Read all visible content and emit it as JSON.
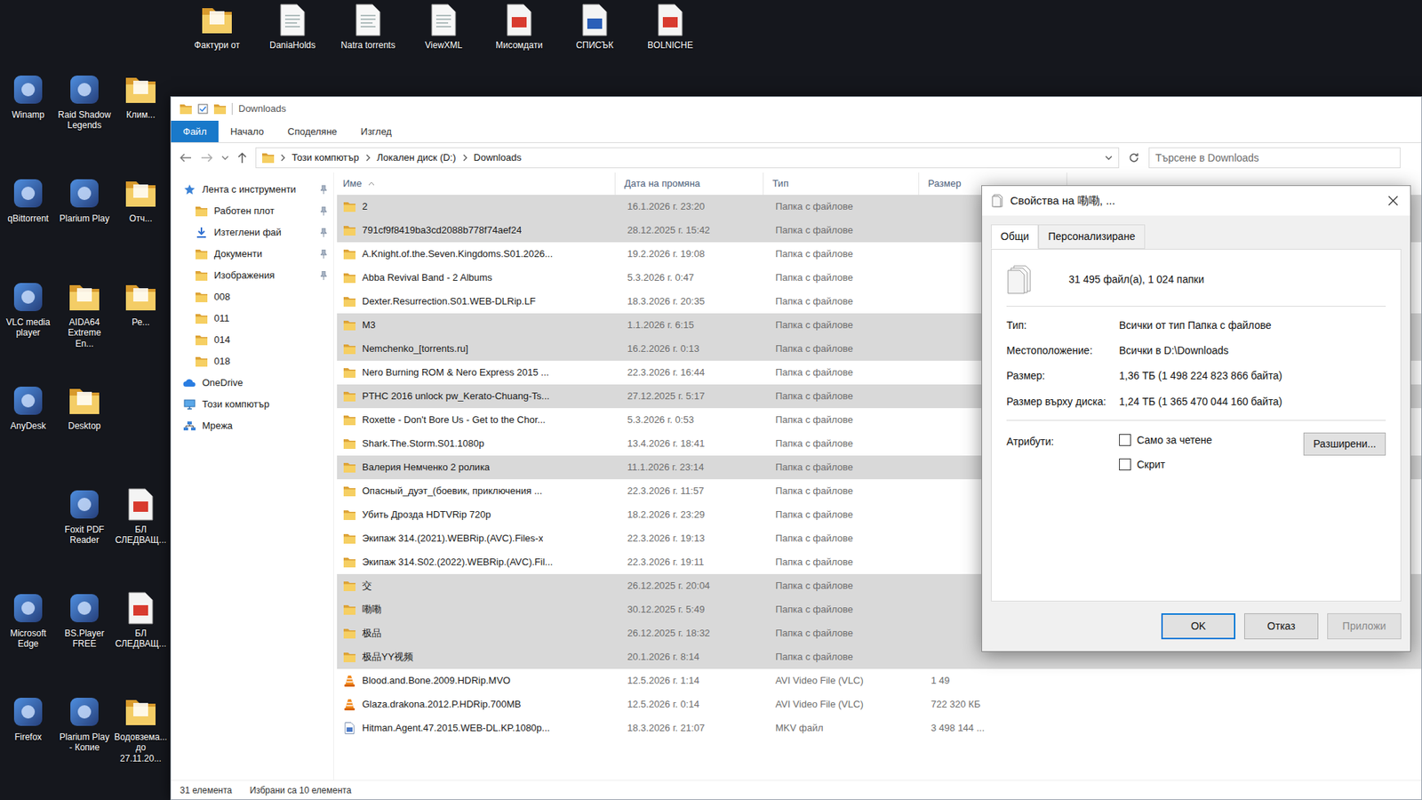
{
  "desktop": {
    "top_icons": [
      {
        "label": "Фактури от",
        "kind": "folder"
      },
      {
        "label": "DaniaHolds",
        "kind": "doc"
      },
      {
        "label": "Natra torrents",
        "kind": "doc"
      },
      {
        "label": "ViewXML",
        "kind": "doc"
      },
      {
        "label": "Мисомдати",
        "kind": "pdf"
      },
      {
        "label": "СПИСЪК",
        "kind": "word"
      },
      {
        "label": "BOLNICHE",
        "kind": "pdf"
      }
    ],
    "icons": [
      {
        "label": "Winamp",
        "kind": "app"
      },
      {
        "label": "Raid Shadow Legends",
        "kind": "app"
      },
      {
        "label": "Клим...",
        "kind": "folder"
      },
      {
        "label": "qBittorrent",
        "kind": "app"
      },
      {
        "label": "Plarium Play",
        "kind": "app"
      },
      {
        "label": "Отч...",
        "kind": "folder"
      },
      {
        "label": "VLC media player",
        "kind": "app"
      },
      {
        "label": "AIDA64 Extreme En...",
        "kind": "folder"
      },
      {
        "label": "Ре...",
        "kind": "folder"
      },
      {
        "label": "AnyDesk",
        "kind": "app"
      },
      {
        "label": "Desktop",
        "kind": "folder"
      },
      {
        "label": "",
        "kind": "empty"
      },
      {
        "label": "",
        "kind": "empty"
      },
      {
        "label": "Foxit PDF Reader",
        "kind": "app"
      },
      {
        "label": "БЛ СЛЕДВАЩ...",
        "kind": "pdf"
      },
      {
        "label": "Microsoft Edge",
        "kind": "app"
      },
      {
        "label": "BS.Player FREE",
        "kind": "app"
      },
      {
        "label": "БЛ СЛЕДВАЩ...",
        "kind": "pdf"
      },
      {
        "label": "Firefox",
        "kind": "app"
      },
      {
        "label": "Plarium Play - Копие",
        "kind": "app"
      },
      {
        "label": "Водовзема... до 27.11.20...",
        "kind": "folder"
      }
    ]
  },
  "explorer": {
    "title": "Downloads",
    "ribbon_tabs": [
      {
        "label": "Файл",
        "selected": true
      },
      {
        "label": "Начало",
        "selected": false
      },
      {
        "label": "Споделяне",
        "selected": false
      },
      {
        "label": "Изглед",
        "selected": false
      }
    ],
    "address": [
      "Този компютър",
      "Локален диск (D:)",
      "Downloads"
    ],
    "search": {
      "placeholder": "Търсене в Downloads"
    },
    "nav": [
      {
        "label": "Лента с инструменти",
        "kind": "quick",
        "pinned": true
      },
      {
        "label": "Работен плот",
        "kind": "folder",
        "pinned": true
      },
      {
        "label": "Изтеглени фай",
        "kind": "download",
        "pinned": true
      },
      {
        "label": "Документи",
        "kind": "folder",
        "pinned": true
      },
      {
        "label": "Изображения",
        "kind": "folder",
        "pinned": true
      },
      {
        "label": "008",
        "kind": "folder",
        "pinned": false
      },
      {
        "label": "011",
        "kind": "folder",
        "pinned": false
      },
      {
        "label": "014",
        "kind": "folder",
        "pinned": false
      },
      {
        "label": "018",
        "kind": "folder",
        "pinned": false
      },
      {
        "label": "OneDrive",
        "kind": "cloud",
        "pinned": false
      },
      {
        "label": "Този компютър",
        "kind": "pc",
        "pinned": false
      },
      {
        "label": "Мрежа",
        "kind": "network",
        "pinned": false
      }
    ],
    "columns": [
      "Име",
      "Дата на промяна",
      "Тип",
      "Размер"
    ],
    "rows": [
      {
        "name": "2",
        "date": "16.1.2026 г. 23:20",
        "type": "Папка с файлове",
        "size": "",
        "kind": "folder",
        "selected": true
      },
      {
        "name": "791cf9f8419ba3cd2088b778f74aef24",
        "date": "28.12.2025 г. 15:42",
        "type": "Папка с файлове",
        "size": "",
        "kind": "folder",
        "selected": true
      },
      {
        "name": "A.Knight.of.the.Seven.Kingdoms.S01.2026...",
        "date": "19.2.2026 г. 19:08",
        "type": "Папка с файлове",
        "size": "",
        "kind": "folder",
        "selected": false
      },
      {
        "name": "Abba Revival Band - 2 Albums",
        "date": "5.3.2026 г. 0:47",
        "type": "Папка с файлове",
        "size": "",
        "kind": "folder",
        "selected": false
      },
      {
        "name": "Dexter.Resurrection.S01.WEB-DLRip.LF",
        "date": "18.3.2026 г. 20:35",
        "type": "Папка с файлове",
        "size": "",
        "kind": "folder",
        "selected": false
      },
      {
        "name": "M3",
        "date": "1.1.2026 г. 6:15",
        "type": "Папка с файлове",
        "size": "",
        "kind": "folder",
        "selected": true
      },
      {
        "name": "Nemchenko_[torrents.ru]",
        "date": "16.2.2026 г. 0:13",
        "type": "Папка с файлове",
        "size": "",
        "kind": "folder",
        "selected": true
      },
      {
        "name": "Nero Burning ROM & Nero Express 2015 ...",
        "date": "22.3.2026 г. 16:44",
        "type": "Папка с файлове",
        "size": "",
        "kind": "folder",
        "selected": false
      },
      {
        "name": "PTHC 2016 unlock pw_Kerato-Chuang-Ts...",
        "date": "27.12.2025 г. 5:17",
        "type": "Папка с файлове",
        "size": "",
        "kind": "folder",
        "selected": true
      },
      {
        "name": "Roxette - Don't Bore Us - Get to the Chor...",
        "date": "5.3.2026 г. 0:53",
        "type": "Папка с файлове",
        "size": "",
        "kind": "folder",
        "selected": false
      },
      {
        "name": "Shark.The.Storm.S01.1080p",
        "date": "13.4.2026 г. 18:41",
        "type": "Папка с файлове",
        "size": "",
        "kind": "folder",
        "selected": false
      },
      {
        "name": "Валерия Немченко 2 ролика",
        "date": "11.1.2026 г. 23:14",
        "type": "Папка с файлове",
        "size": "",
        "kind": "folder",
        "selected": true
      },
      {
        "name": "Опасный_дуэт_(боевик, приключения ...",
        "date": "22.3.2026 г. 11:57",
        "type": "Папка с файлове",
        "size": "",
        "kind": "folder",
        "selected": false
      },
      {
        "name": "Убить Дрозда HDTVRip 720p",
        "date": "18.2.2026 г. 23:29",
        "type": "Папка с файлове",
        "size": "",
        "kind": "folder",
        "selected": false
      },
      {
        "name": "Экипаж 314.(2021).WEBRip.(AVC).Files-x",
        "date": "22.3.2026 г. 19:13",
        "type": "Папка с файлове",
        "size": "",
        "kind": "folder",
        "selected": false
      },
      {
        "name": "Экипаж 314.S02.(2022).WEBRip.(AVC).Fil...",
        "date": "22.3.2026 г. 19:11",
        "type": "Папка с файлове",
        "size": "",
        "kind": "folder",
        "selected": false
      },
      {
        "name": "交",
        "date": "26.12.2025 г. 20:04",
        "type": "Папка с файлове",
        "size": "",
        "kind": "folder",
        "selected": true
      },
      {
        "name": "嘞嘞",
        "date": "30.12.2025 г. 5:49",
        "type": "Папка с файлове",
        "size": "",
        "kind": "folder",
        "selected": true
      },
      {
        "name": "极品",
        "date": "26.12.2025 г. 18:32",
        "type": "Папка с файлове",
        "size": "",
        "kind": "folder",
        "selected": true
      },
      {
        "name": "极品YY视频",
        "date": "20.1.2026 г. 8:14",
        "type": "Папка с файлове",
        "size": "",
        "kind": "folder",
        "selected": true
      },
      {
        "name": "Blood.and.Bone.2009.HDRip.MVO",
        "date": "12.5.2026 г. 1:14",
        "type": "AVI Video File (VLC)",
        "size": "1 49",
        "kind": "video",
        "selected": false
      },
      {
        "name": "Glaza.drakona.2012.P.HDRip.700MB",
        "date": "12.5.2026 г. 0:14",
        "type": "AVI Video File (VLC)",
        "size": "722 320 КБ",
        "kind": "video",
        "selected": false
      },
      {
        "name": "Hitman.Agent.47.2015.WEB-DL.KP.1080p...",
        "date": "18.3.2026 г. 21:07",
        "type": "MKV файл",
        "size": "3 498 144 ...",
        "kind": "mkv",
        "selected": false
      }
    ],
    "status": {
      "count": "31 елемента",
      "selection": "Избрани са 10 елемента"
    }
  },
  "dialog": {
    "title": "Свойства на 嘞嘞, ...",
    "tabs": [
      {
        "label": "Общи",
        "selected": true
      },
      {
        "label": "Персонализиране",
        "selected": false
      }
    ],
    "summary": "31 495 файл(а), 1 024 папки",
    "properties": [
      {
        "label": "Тип:",
        "value": "Всички от тип Папка с файлове"
      },
      {
        "label": "Местоположение:",
        "value": "Всички в D:\\Downloads"
      },
      {
        "label": "Размер:",
        "value": "1,36 ТБ (1 498 224 823 866 байта)"
      },
      {
        "label": "Размер върху диска:",
        "value": "1,24 ТБ (1 365 470 044 160 байта)"
      }
    ],
    "attributes_label": "Атрибути:",
    "attributes": [
      {
        "label": "Само за четене",
        "checked": false
      },
      {
        "label": "Скрит",
        "checked": false
      }
    ],
    "advanced_button": "Разширени...",
    "buttons": [
      {
        "label": "OK",
        "default": true,
        "disabled": false
      },
      {
        "label": "Отказ",
        "default": false,
        "disabled": false
      },
      {
        "label": "Приложи",
        "default": false,
        "disabled": true
      }
    ]
  }
}
